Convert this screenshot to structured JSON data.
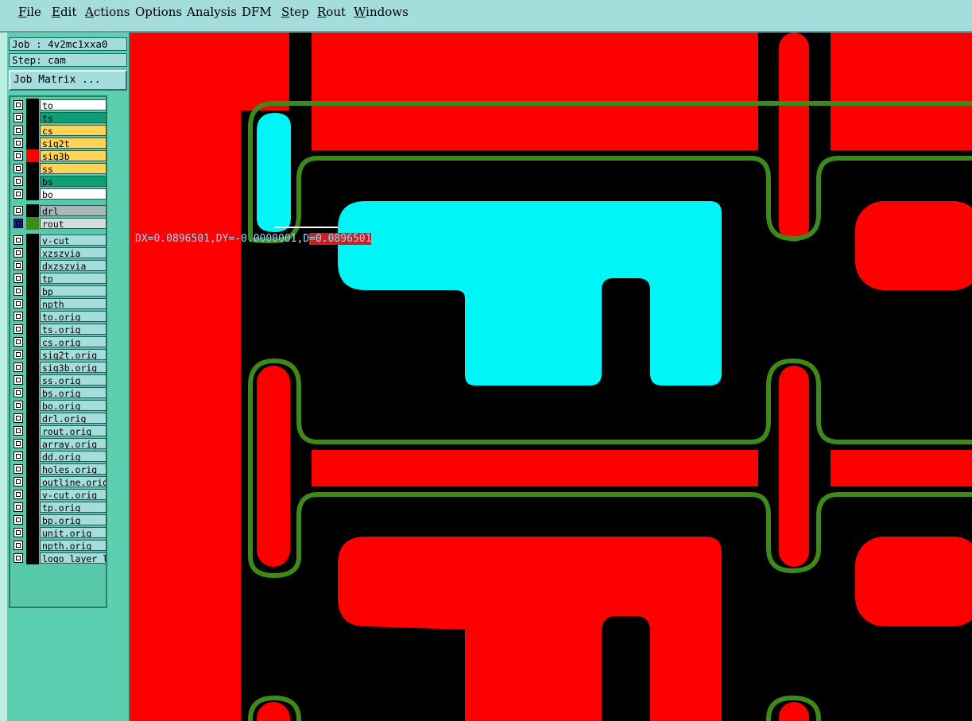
{
  "menu": [
    {
      "label": "File",
      "name": "menu-file"
    },
    {
      "label": "Edit",
      "name": "menu-edit"
    },
    {
      "label": "Actions",
      "name": "menu-actions"
    },
    {
      "label": "Options",
      "name": "menu-options"
    },
    {
      "label": "Analysis",
      "name": "menu-analysis"
    },
    {
      "label": "DFM",
      "name": "menu-dfm"
    },
    {
      "label": "Step",
      "name": "menu-step"
    },
    {
      "label": "Rout",
      "name": "menu-rout"
    },
    {
      "label": "Windows",
      "name": "menu-windows"
    }
  ],
  "job": {
    "label": "Job : 4v2mc1xxa0"
  },
  "step": {
    "label": "Step: cam"
  },
  "job_matrix": {
    "label": "Job Matrix ..."
  },
  "layers": [
    {
      "name": "to",
      "bg": "#ffffff",
      "swatch": "#000000"
    },
    {
      "name": "ts",
      "bg": "#0f9f76",
      "swatch": "#000000"
    },
    {
      "name": "cs",
      "bg": "#ffd35a",
      "swatch": "#000000"
    },
    {
      "name": "sig2t",
      "bg": "#ffd35a",
      "swatch": "#000000"
    },
    {
      "name": "sig3b",
      "bg": "#ffd35a",
      "swatch": "#ff0000"
    },
    {
      "name": "ss",
      "bg": "#ffd35a",
      "swatch": "#000000"
    },
    {
      "name": "bs",
      "bg": "#0f9f76",
      "swatch": "#000000"
    },
    {
      "name": "bo",
      "bg": "#ffffff",
      "swatch": "#000000"
    },
    {
      "name": "drl",
      "bg": "#a9b7b7",
      "swatch": "#000000"
    },
    {
      "name": "rout",
      "bg": "#d4dede",
      "swatch": "#3d8a1a",
      "active": true
    },
    {
      "name": "v-cut",
      "bg": "#a5dcdc",
      "swatch": "#000000"
    },
    {
      "name": "xzszvia",
      "bg": "#a5dcdc",
      "swatch": "#000000"
    },
    {
      "name": "dxzszvia",
      "bg": "#a5dcdc",
      "swatch": "#000000"
    },
    {
      "name": "tp",
      "bg": "#a5dcdc",
      "swatch": "#000000"
    },
    {
      "name": "bp",
      "bg": "#a5dcdc",
      "swatch": "#000000"
    },
    {
      "name": "npth",
      "bg": "#a5dcdc",
      "swatch": "#000000"
    },
    {
      "name": "to.orig",
      "bg": "#a5dcdc",
      "swatch": "#000000"
    },
    {
      "name": "ts.orig",
      "bg": "#a5dcdc",
      "swatch": "#000000"
    },
    {
      "name": "cs.orig",
      "bg": "#a5dcdc",
      "swatch": "#000000"
    },
    {
      "name": "sig2t.orig",
      "bg": "#a5dcdc",
      "swatch": "#000000"
    },
    {
      "name": "sig3b.orig",
      "bg": "#a5dcdc",
      "swatch": "#000000"
    },
    {
      "name": "ss.orig",
      "bg": "#a5dcdc",
      "swatch": "#000000"
    },
    {
      "name": "bs.orig",
      "bg": "#a5dcdc",
      "swatch": "#000000"
    },
    {
      "name": "bo.orig",
      "bg": "#a5dcdc",
      "swatch": "#000000"
    },
    {
      "name": "drl.orig",
      "bg": "#a5dcdc",
      "swatch": "#000000"
    },
    {
      "name": "rout.orig",
      "bg": "#a5dcdc",
      "swatch": "#000000"
    },
    {
      "name": "array.orig",
      "bg": "#a5dcdc",
      "swatch": "#000000"
    },
    {
      "name": "dd.orig",
      "bg": "#a5dcdc",
      "swatch": "#000000"
    },
    {
      "name": "holes.orig",
      "bg": "#a5dcdc",
      "swatch": "#000000"
    },
    {
      "name": "outline.orig",
      "bg": "#a5dcdc",
      "swatch": "#000000"
    },
    {
      "name": "v-cut.orig",
      "bg": "#a5dcdc",
      "swatch": "#000000"
    },
    {
      "name": "tp.orig",
      "bg": "#a5dcdc",
      "swatch": "#000000"
    },
    {
      "name": "bp.orig",
      "bg": "#a5dcdc",
      "swatch": "#000000"
    },
    {
      "name": "unit.orig",
      "bg": "#a5dcdc",
      "swatch": "#000000"
    },
    {
      "name": "npth.orig",
      "bg": "#a5dcdc",
      "swatch": "#000000"
    },
    {
      "name": "logo_layer_l",
      "bg": "#a5dcdc",
      "swatch": "#000000"
    }
  ],
  "measurement": {
    "part1": "DX=0.0896501,DY=-0.0000001,D",
    "part2": "=0.0896501"
  },
  "colors": {
    "copper": "#ff0000",
    "rout": "#3d8a1a",
    "highlight": "#00f6f6",
    "background": "#000000"
  }
}
